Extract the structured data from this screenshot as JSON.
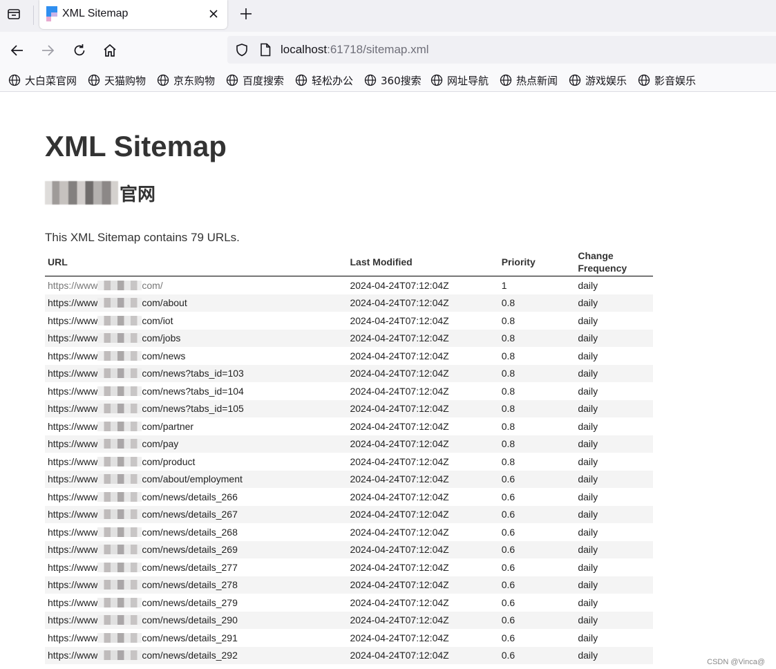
{
  "browser": {
    "tab_title": "XML Sitemap",
    "url_host": "localhost",
    "url_rest": ":61718/sitemap.xml",
    "bookmarks": [
      "大白菜官网",
      "天猫购物",
      "京东购物",
      "百度搜索",
      "轻松办公",
      "360搜索",
      "网址导航",
      "热点新闻",
      "游戏娱乐",
      "影音娱乐"
    ]
  },
  "page": {
    "title": "XML Sitemap",
    "site_suffix": "官网",
    "summary": "This XML Sitemap contains 79 URLs."
  },
  "table": {
    "headers": {
      "url": "URL",
      "modified": "Last Modified",
      "priority": "Priority",
      "changefreq": "Change Frequency"
    },
    "url_prefix": "https://www",
    "rows": [
      {
        "path": "com/",
        "modified": "2024-04-24T07:12:04Z",
        "priority": "1",
        "changefreq": "daily"
      },
      {
        "path": "com/about",
        "modified": "2024-04-24T07:12:04Z",
        "priority": "0.8",
        "changefreq": "daily"
      },
      {
        "path": "com/iot",
        "modified": "2024-04-24T07:12:04Z",
        "priority": "0.8",
        "changefreq": "daily"
      },
      {
        "path": "com/jobs",
        "modified": "2024-04-24T07:12:04Z",
        "priority": "0.8",
        "changefreq": "daily"
      },
      {
        "path": "com/news",
        "modified": "2024-04-24T07:12:04Z",
        "priority": "0.8",
        "changefreq": "daily"
      },
      {
        "path": "com/news?tabs_id=103",
        "modified": "2024-04-24T07:12:04Z",
        "priority": "0.8",
        "changefreq": "daily"
      },
      {
        "path": "com/news?tabs_id=104",
        "modified": "2024-04-24T07:12:04Z",
        "priority": "0.8",
        "changefreq": "daily"
      },
      {
        "path": "com/news?tabs_id=105",
        "modified": "2024-04-24T07:12:04Z",
        "priority": "0.8",
        "changefreq": "daily"
      },
      {
        "path": "com/partner",
        "modified": "2024-04-24T07:12:04Z",
        "priority": "0.8",
        "changefreq": "daily"
      },
      {
        "path": "com/pay",
        "modified": "2024-04-24T07:12:04Z",
        "priority": "0.8",
        "changefreq": "daily"
      },
      {
        "path": "com/product",
        "modified": "2024-04-24T07:12:04Z",
        "priority": "0.8",
        "changefreq": "daily"
      },
      {
        "path": "com/about/employment",
        "modified": "2024-04-24T07:12:04Z",
        "priority": "0.6",
        "changefreq": "daily"
      },
      {
        "path": "com/news/details_266",
        "modified": "2024-04-24T07:12:04Z",
        "priority": "0.6",
        "changefreq": "daily"
      },
      {
        "path": "com/news/details_267",
        "modified": "2024-04-24T07:12:04Z",
        "priority": "0.6",
        "changefreq": "daily"
      },
      {
        "path": "com/news/details_268",
        "modified": "2024-04-24T07:12:04Z",
        "priority": "0.6",
        "changefreq": "daily"
      },
      {
        "path": "com/news/details_269",
        "modified": "2024-04-24T07:12:04Z",
        "priority": "0.6",
        "changefreq": "daily"
      },
      {
        "path": "com/news/details_277",
        "modified": "2024-04-24T07:12:04Z",
        "priority": "0.6",
        "changefreq": "daily"
      },
      {
        "path": "com/news/details_278",
        "modified": "2024-04-24T07:12:04Z",
        "priority": "0.6",
        "changefreq": "daily"
      },
      {
        "path": "com/news/details_279",
        "modified": "2024-04-24T07:12:04Z",
        "priority": "0.6",
        "changefreq": "daily"
      },
      {
        "path": "com/news/details_290",
        "modified": "2024-04-24T07:12:04Z",
        "priority": "0.6",
        "changefreq": "daily"
      },
      {
        "path": "com/news/details_291",
        "modified": "2024-04-24T07:12:04Z",
        "priority": "0.6",
        "changefreq": "daily"
      },
      {
        "path": "com/news/details_292",
        "modified": "2024-04-24T07:12:04Z",
        "priority": "0.6",
        "changefreq": "daily"
      }
    ]
  },
  "watermark": "CSDN @Vinca@"
}
